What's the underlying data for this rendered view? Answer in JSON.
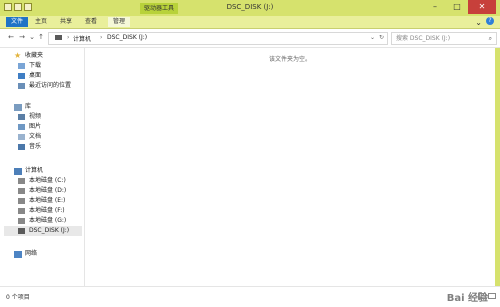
{
  "window": {
    "title": "DSC_DISK (J:)",
    "tools_badge": "驱动器工具"
  },
  "ribbon": {
    "tabs": [
      "文件",
      "主页",
      "共享",
      "查看",
      "管理"
    ]
  },
  "address": {
    "crumbs": [
      "计算机",
      "DSC_DISK (J:)"
    ]
  },
  "search": {
    "placeholder": "搜索 DSC_DISK (J:)"
  },
  "sidebar": {
    "favorites": {
      "label": "收藏夹",
      "items": [
        "下载",
        "桌面",
        "最近访问的位置"
      ]
    },
    "libraries": {
      "label": "库",
      "items": [
        "视频",
        "图片",
        "文档",
        "音乐"
      ]
    },
    "computer": {
      "label": "计算机",
      "items": [
        "本地磁盘 (C:)",
        "本地磁盘 (D:)",
        "本地磁盘 (E:)",
        "本地磁盘 (F:)",
        "本地磁盘 (G:)",
        "DSC_DISK (J:)"
      ]
    },
    "network": {
      "label": "网络"
    }
  },
  "main": {
    "empty_text": "该文件夹为空。"
  },
  "status": {
    "count": "0 个项目"
  },
  "watermark": "Bai 经验"
}
